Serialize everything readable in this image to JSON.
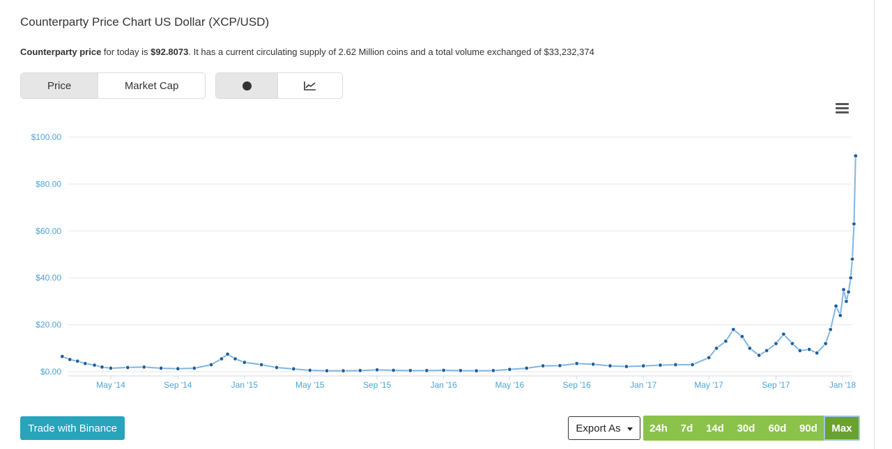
{
  "title": "Counterparty Price Chart US Dollar (XCP/USD)",
  "description": {
    "prefix_bold": "Counterparty price",
    "mid": " for today is ",
    "price_bold": "$92.8073",
    "suffix": ". It has a current circulating supply of 2.62 Million coins and a total volume exchanged of $33,232,374"
  },
  "toggle_metric": {
    "options": [
      "Price",
      "Market Cap"
    ],
    "selected": "Price"
  },
  "toggle_style": {
    "options": [
      "dot-icon",
      "line-chart-icon"
    ],
    "selected": "dot-icon"
  },
  "menu_icon": "hamburger-menu-icon",
  "buttons": {
    "trade": "Trade with Binance",
    "export": "Export As"
  },
  "ranges": {
    "options": [
      "24h",
      "7d",
      "14d",
      "30d",
      "60d",
      "90d",
      "Max"
    ],
    "selected": "Max"
  },
  "colors": {
    "axis_label": "#4aa4d8",
    "series": "#1f5f9e",
    "series_line": "#7fb5e0",
    "range_bg": "#8bc34a",
    "binance": "#28a4bb"
  },
  "chart_data": {
    "type": "line",
    "x_unit": "date",
    "y_unit": "USD",
    "y_ticks": [
      "$0.00",
      "$20.00",
      "$40.00",
      "$60.00",
      "$80.00",
      "$100.00"
    ],
    "ylim": [
      0,
      100
    ],
    "x_ticks": [
      "May '14",
      "Sep '14",
      "Jan '15",
      "May '15",
      "Sep '15",
      "Jan '16",
      "May '16",
      "Sep '16",
      "Jan '17",
      "May '17",
      "Sep '17",
      "Jan '18"
    ],
    "xlim": [
      "2014-02-01",
      "2018-01-25"
    ],
    "grid": true,
    "series": [
      {
        "x": [
          "2014-02-01",
          "2014-02-15",
          "2014-03-01",
          "2014-03-15",
          "2014-04-01",
          "2014-04-15",
          "2014-05-01",
          "2014-06-01",
          "2014-07-01",
          "2014-08-01",
          "2014-09-01",
          "2014-10-01",
          "2014-11-01",
          "2014-11-20",
          "2014-12-01",
          "2014-12-15",
          "2015-01-01",
          "2015-02-01",
          "2015-03-01",
          "2015-04-01",
          "2015-05-01",
          "2015-06-01",
          "2015-07-01",
          "2015-08-01",
          "2015-09-01",
          "2015-10-01",
          "2015-11-01",
          "2015-12-01",
          "2016-01-01",
          "2016-02-01",
          "2016-03-01",
          "2016-04-01",
          "2016-05-01",
          "2016-06-01",
          "2016-07-01",
          "2016-08-01",
          "2016-09-01",
          "2016-10-01",
          "2016-11-01",
          "2016-12-01",
          "2017-01-01",
          "2017-02-01",
          "2017-03-01",
          "2017-04-01",
          "2017-05-01",
          "2017-05-15",
          "2017-06-01",
          "2017-06-15",
          "2017-07-01",
          "2017-07-15",
          "2017-08-01",
          "2017-08-15",
          "2017-09-01",
          "2017-09-15",
          "2017-10-01",
          "2017-10-15",
          "2017-11-01",
          "2017-11-15",
          "2017-12-01",
          "2017-12-10",
          "2017-12-20",
          "2017-12-28",
          "2018-01-03",
          "2018-01-08",
          "2018-01-12",
          "2018-01-16",
          "2018-01-19",
          "2018-01-22",
          "2018-01-25"
        ],
        "y": [
          6.5,
          5.2,
          4.5,
          3.5,
          2.8,
          2.0,
          1.5,
          1.8,
          2.0,
          1.5,
          1.3,
          1.5,
          3.0,
          5.5,
          7.5,
          5.5,
          4.0,
          3.0,
          1.8,
          1.2,
          0.6,
          0.4,
          0.4,
          0.5,
          0.8,
          0.6,
          0.5,
          0.5,
          0.6,
          0.5,
          0.4,
          0.5,
          1.0,
          1.5,
          2.5,
          2.6,
          3.5,
          3.2,
          2.5,
          2.2,
          2.5,
          2.8,
          3.0,
          3.0,
          6.0,
          10.0,
          13.0,
          18.0,
          15.0,
          10.0,
          7.0,
          9.0,
          12.0,
          16.0,
          12.0,
          9.0,
          9.5,
          8.0,
          12.0,
          18.0,
          28.0,
          24.0,
          35.0,
          30.0,
          34.0,
          40.0,
          48.0,
          63.0,
          92.0
        ]
      }
    ]
  }
}
